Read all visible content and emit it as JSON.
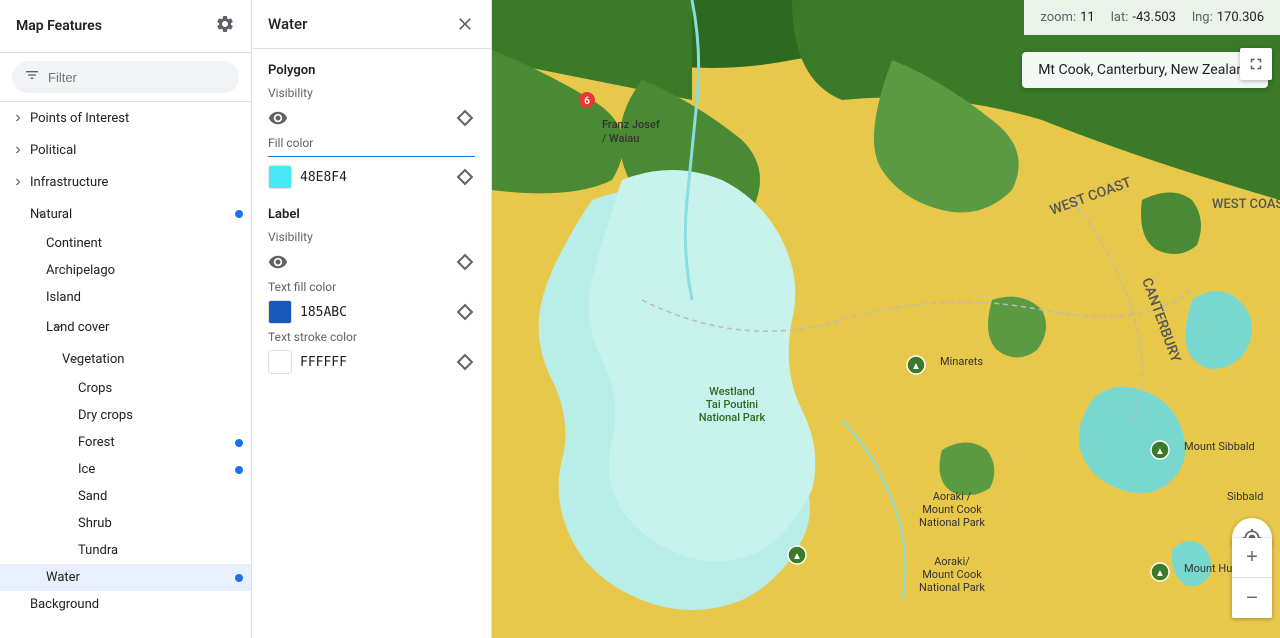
{
  "leftPanel": {
    "title": "Map Features",
    "filterPlaceholder": "Filter",
    "items": [
      {
        "id": "points-of-interest",
        "label": "Points of Interest",
        "level": 0,
        "hasChevron": true,
        "chevronDir": "right",
        "hasDot": false
      },
      {
        "id": "political",
        "label": "Political",
        "level": 0,
        "hasChevron": true,
        "chevronDir": "right",
        "hasDot": false
      },
      {
        "id": "infrastructure",
        "label": "Infrastructure",
        "level": 0,
        "hasChevron": true,
        "chevronDir": "right",
        "hasDot": false
      },
      {
        "id": "natural",
        "label": "Natural",
        "level": 0,
        "hasChevron": true,
        "chevronDir": "down",
        "hasDot": true
      },
      {
        "id": "continent",
        "label": "Continent",
        "level": 1,
        "hasChevron": false,
        "hasDot": false
      },
      {
        "id": "archipelago",
        "label": "Archipelago",
        "level": 1,
        "hasChevron": false,
        "hasDot": false
      },
      {
        "id": "island",
        "label": "Island",
        "level": 1,
        "hasChevron": false,
        "hasDot": false
      },
      {
        "id": "land-cover",
        "label": "Land cover",
        "level": 1,
        "hasChevron": true,
        "chevronDir": "down",
        "hasDot": false
      },
      {
        "id": "vegetation",
        "label": "Vegetation",
        "level": 2,
        "hasChevron": true,
        "chevronDir": "down",
        "hasDot": false
      },
      {
        "id": "crops",
        "label": "Crops",
        "level": 3,
        "hasChevron": false,
        "hasDot": false
      },
      {
        "id": "dry-crops",
        "label": "Dry crops",
        "level": 3,
        "hasChevron": false,
        "hasDot": false
      },
      {
        "id": "forest",
        "label": "Forest",
        "level": 3,
        "hasChevron": false,
        "hasDot": true
      },
      {
        "id": "ice",
        "label": "Ice",
        "level": 3,
        "hasChevron": false,
        "hasDot": true
      },
      {
        "id": "sand",
        "label": "Sand",
        "level": 3,
        "hasChevron": false,
        "hasDot": false
      },
      {
        "id": "shrub",
        "label": "Shrub",
        "level": 3,
        "hasChevron": false,
        "hasDot": false
      },
      {
        "id": "tundra",
        "label": "Tundra",
        "level": 3,
        "hasChevron": false,
        "hasDot": false
      },
      {
        "id": "water",
        "label": "Water",
        "level": 1,
        "hasChevron": false,
        "hasDot": true,
        "active": true
      },
      {
        "id": "background",
        "label": "Background",
        "level": 0,
        "hasChevron": false,
        "hasDot": false
      }
    ]
  },
  "middlePanel": {
    "title": "Water",
    "sections": [
      {
        "id": "polygon",
        "title": "Polygon",
        "fields": [
          {
            "id": "visibility",
            "label": "Visibility",
            "type": "eye"
          },
          {
            "id": "fill-color",
            "label": "Fill color",
            "type": "color",
            "color": "#48E8F4",
            "hex": "48E8F4",
            "hasLine": true
          }
        ]
      },
      {
        "id": "label",
        "title": "Label",
        "fields": [
          {
            "id": "label-visibility",
            "label": "Visibility",
            "type": "eye"
          },
          {
            "id": "text-fill-color",
            "label": "Text fill color",
            "type": "color",
            "color": "#185ABC",
            "hex": "185ABC"
          },
          {
            "id": "text-stroke-color",
            "label": "Text stroke color",
            "type": "color",
            "color": "#FFFFFF",
            "hex": "FFFFFF"
          }
        ]
      }
    ]
  },
  "map": {
    "zoom": "11",
    "lat": "-43.503",
    "lng": "170.306",
    "location": "Mt Cook, Canterbury, New Zealand"
  },
  "icons": {
    "gear": "⚙",
    "filter": "≡",
    "close": "✕",
    "eye": "👁",
    "diamond": "◇",
    "fullscreen": "⛶",
    "location": "◎",
    "plus": "+",
    "minus": "−"
  }
}
